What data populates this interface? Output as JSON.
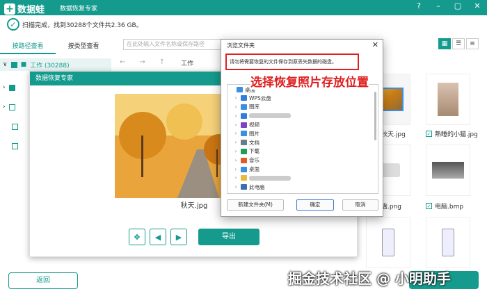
{
  "titlebar": {
    "logo_text": "数据蛙",
    "app_title": "数据恢复专家",
    "help": "?",
    "minimize": "–",
    "maximize": "▢",
    "close": "✕"
  },
  "status": {
    "text": "扫描完成，找到30288个文件共2.36 GB。"
  },
  "tabs": [
    {
      "label": "按路径查看"
    },
    {
      "label": "按类型查看"
    }
  ],
  "tree": {
    "root_label": "工作 (30288)"
  },
  "search": {
    "placeholder": "在此处输入文件名称或保存路径"
  },
  "nav": {
    "back": "←",
    "forward": "→",
    "up": "↑",
    "path": "工作"
  },
  "thumbs": [
    {
      "caption": "秋天.jpg",
      "checked": false
    },
    {
      "caption": "熟睡的小猫.jpg",
      "checked": true
    },
    {
      "caption": "盘.png",
      "checked": false
    },
    {
      "caption": "电脑.bmp",
      "checked": true
    }
  ],
  "preview": {
    "title": "数据恢复专家",
    "caption": "秋天.jpg",
    "export": "导出"
  },
  "dialog": {
    "title": "浏览文件夹",
    "message": "请勿将需要恢复的文件保存到原丢失数据的磁盘。",
    "annotation": "选择恢复照片存放位置",
    "folders": [
      {
        "label": "桌面",
        "icon": "desktop-icon",
        "color": "#3a8ee6",
        "indent": 0,
        "arrow": ""
      },
      {
        "label": "WPS云盘",
        "icon": "cloud-icon",
        "color": "#2f7de1",
        "indent": 1,
        "arrow": "›"
      },
      {
        "label": "图库",
        "icon": "gallery-icon",
        "color": "#3a8ee6",
        "indent": 1,
        "arrow": "›"
      },
      {
        "label": "",
        "icon": "onedrive-icon",
        "color": "#2f7de1",
        "indent": 1,
        "arrow": "›"
      },
      {
        "label": "视频",
        "icon": "video-icon",
        "color": "#7a42c4",
        "indent": 1,
        "arrow": "›"
      },
      {
        "label": "图片",
        "icon": "picture-icon",
        "color": "#3a8ee6",
        "indent": 1,
        "arrow": "›"
      },
      {
        "label": "文档",
        "icon": "document-icon",
        "color": "#6a7b8c",
        "indent": 1,
        "arrow": "›"
      },
      {
        "label": "下载",
        "icon": "download-icon",
        "color": "#1e9e5a",
        "indent": 1,
        "arrow": "›"
      },
      {
        "label": "音乐",
        "icon": "music-icon",
        "color": "#e05a2b",
        "indent": 1,
        "arrow": "›"
      },
      {
        "label": "桌面",
        "icon": "desktop-icon",
        "color": "#3a8ee6",
        "indent": 1,
        "arrow": "›"
      },
      {
        "label": "",
        "icon": "folder-icon",
        "color": "#e8b93a",
        "indent": 1,
        "arrow": "›"
      },
      {
        "label": "此电脑",
        "icon": "computer-icon",
        "color": "#3a6fb0",
        "indent": 1,
        "arrow": "›"
      }
    ],
    "new_folder": "新建文件夹(M)",
    "ok": "确定",
    "cancel": "取消"
  },
  "bottom": {
    "back": "返回"
  },
  "watermark": "掘金技术社区 @ 小明助手",
  "colors": {
    "accent": "#159b8e",
    "annotation": "#e02020"
  }
}
